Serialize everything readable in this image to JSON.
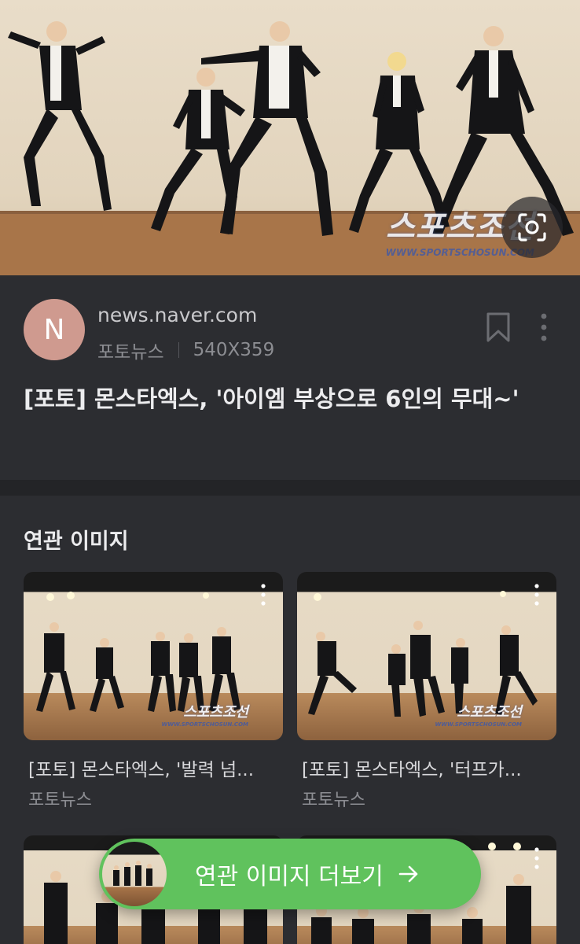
{
  "hero": {
    "watermark_main": "스포츠조선",
    "watermark_url": "WWW.SPORTSCHOSUN.COM"
  },
  "source": {
    "avatar_letter": "N",
    "domain": "news.naver.com",
    "category": "포토뉴스",
    "dimensions": "540X359",
    "title": "[포토] 몬스타엑스, '아이엠 부상으로 6인의 무대~'"
  },
  "related": {
    "heading": "연관 이미지",
    "cards": [
      {
        "caption": "[포토] 몬스타엑스, '발력 넘...",
        "category": "포토뉴스",
        "watermark": "스포츠조선",
        "watermark_url": "WWW.SPORTSCHOSUN.COM"
      },
      {
        "caption": "[포토] 몬스타엑스, '터프가...",
        "category": "포토뉴스",
        "watermark": "스포츠조선",
        "watermark_url": "WWW.SPORTSCHOSUN.COM"
      }
    ]
  },
  "more_button": {
    "label": "연관 이미지 더보기"
  },
  "colors": {
    "background": "#2c2d31",
    "accent_green": "#60c25d",
    "avatar": "#cf9a8f"
  }
}
